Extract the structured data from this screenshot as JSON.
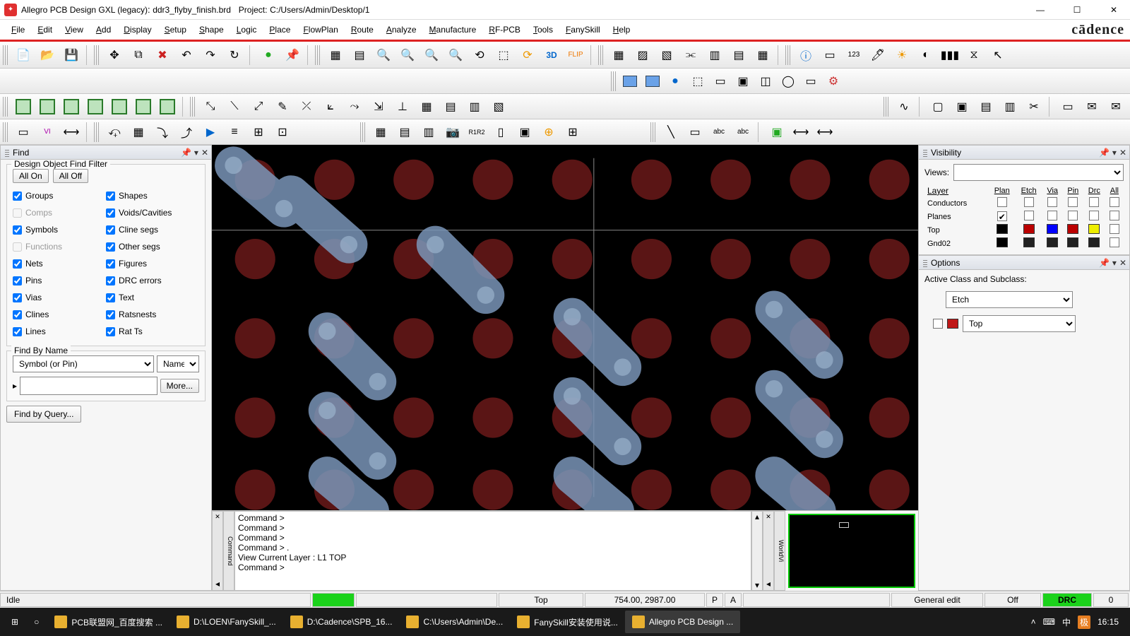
{
  "titlebar": {
    "app": "Allegro PCB Design GXL (legacy)",
    "file": "ddr3_flyby_finish.brd",
    "project_label": "Project:",
    "project_path": "C:/Users/Admin/Desktop/1"
  },
  "menus": [
    "File",
    "Edit",
    "View",
    "Add",
    "Display",
    "Setup",
    "Shape",
    "Logic",
    "Place",
    "FlowPlan",
    "Route",
    "Analyze",
    "Manufacture",
    "RF-PCB",
    "Tools",
    "FanySkill",
    "Help"
  ],
  "brand": "cādence",
  "find": {
    "title": "Find",
    "group1": "Design Object Find Filter",
    "all_on": "All On",
    "all_off": "All Off",
    "left_items": [
      {
        "label": "Groups",
        "checked": true,
        "enabled": true
      },
      {
        "label": "Comps",
        "checked": false,
        "enabled": false
      },
      {
        "label": "Symbols",
        "checked": true,
        "enabled": true
      },
      {
        "label": "Functions",
        "checked": false,
        "enabled": false
      },
      {
        "label": "Nets",
        "checked": true,
        "enabled": true
      },
      {
        "label": "Pins",
        "checked": true,
        "enabled": true
      },
      {
        "label": "Vias",
        "checked": true,
        "enabled": true
      },
      {
        "label": "Clines",
        "checked": true,
        "enabled": true
      },
      {
        "label": "Lines",
        "checked": true,
        "enabled": true
      }
    ],
    "right_items": [
      {
        "label": "Shapes",
        "checked": true,
        "enabled": true
      },
      {
        "label": "Voids/Cavities",
        "checked": true,
        "enabled": true
      },
      {
        "label": "Cline segs",
        "checked": true,
        "enabled": true
      },
      {
        "label": "Other segs",
        "checked": true,
        "enabled": true
      },
      {
        "label": "Figures",
        "checked": true,
        "enabled": true
      },
      {
        "label": "DRC errors",
        "checked": true,
        "enabled": true
      },
      {
        "label": "Text",
        "checked": true,
        "enabled": true
      },
      {
        "label": "Ratsnests",
        "checked": true,
        "enabled": true
      },
      {
        "label": "Rat Ts",
        "checked": true,
        "enabled": true
      }
    ],
    "find_by_name": "Find By Name",
    "symbol_combo": "Symbol (or Pin)",
    "name_combo": "Name",
    "more": "More...",
    "query": "Find by Query..."
  },
  "visibility": {
    "title": "Visibility",
    "views": "Views:",
    "layer": "Layer",
    "cols": [
      "Plan",
      "Etch",
      "Via",
      "Pin",
      "Drc",
      "All"
    ],
    "rows": [
      {
        "label": "Conductors",
        "type": "check"
      },
      {
        "label": "Planes",
        "type": "check",
        "checked0": true
      }
    ],
    "layers": [
      {
        "name": "Top",
        "colors": [
          "#000",
          "#b00",
          "#00f",
          "#b00",
          "#ee0",
          ""
        ]
      },
      {
        "name": "Gnd02",
        "colors": [
          "#000",
          "#222",
          "#222",
          "#222",
          "#222",
          ""
        ]
      }
    ]
  },
  "options": {
    "title": "Options",
    "label": "Active Class and Subclass:",
    "class": "Etch",
    "subclass": "Top",
    "sub_color": "#c01818"
  },
  "cmdlog": [
    "Command >",
    "Command >",
    "Command >",
    "Command > .",
    "View Current Layer :   L1        TOP",
    "Command >"
  ],
  "cmd_side": "Command",
  "wv_side": "WorldVi",
  "status": {
    "idle": "Idle",
    "layer": "Top",
    "coords": "754.00, 2987.00",
    "p": "P",
    "a": "A",
    "mode": "General edit",
    "off": "Off",
    "drc": "DRC",
    "count": "0"
  },
  "taskbar": {
    "items": [
      "PCB联盟网_百度搜索 ...",
      "D:\\LOEN\\FanySkill_...",
      "D:\\Cadence\\SPB_16...",
      "C:\\Users\\Admin\\De...",
      "FanySkill安装使用说...",
      "Allegro PCB Design ..."
    ],
    "ime": "中",
    "clock": "16:15"
  }
}
